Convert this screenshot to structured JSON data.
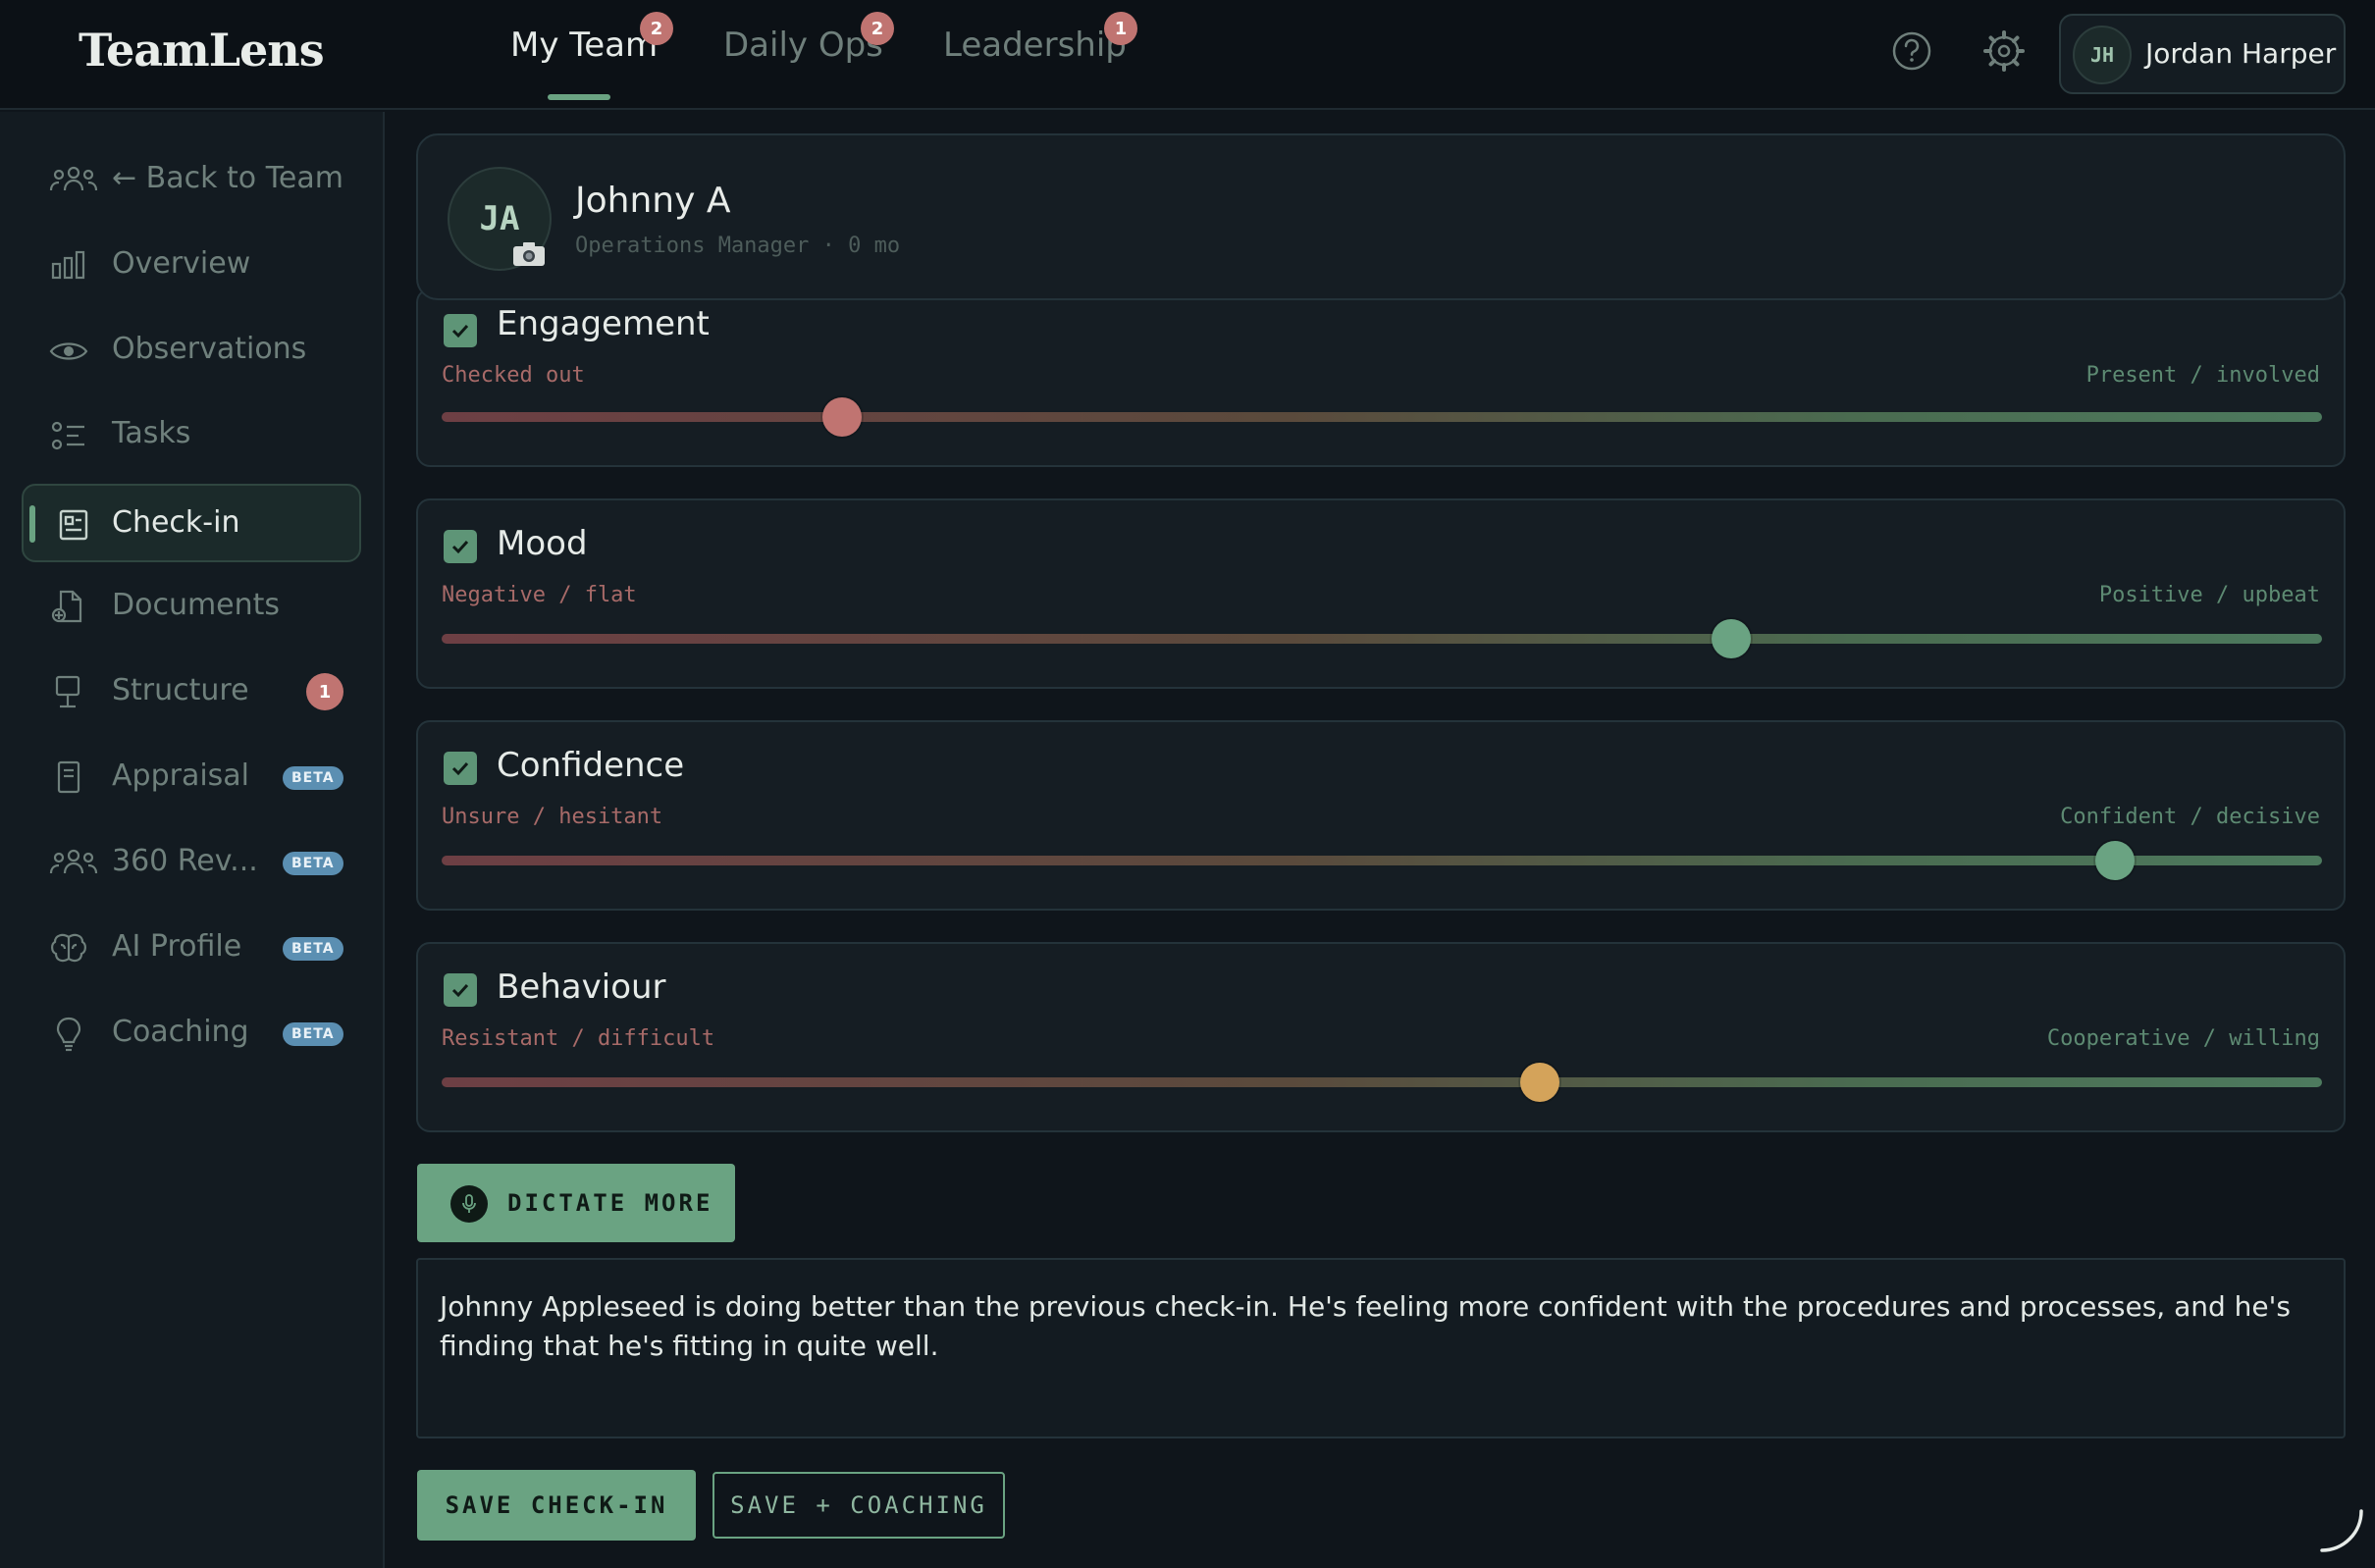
{
  "app": {
    "logo": "TeamLens",
    "tabs": [
      {
        "label": "My Team",
        "badge": "2"
      },
      {
        "label": "Daily Ops",
        "badge": "2"
      },
      {
        "label": "Leadership",
        "badge": "1"
      }
    ],
    "user": {
      "initials": "JH",
      "name": "Jordan Harper"
    }
  },
  "sidebar": {
    "items": [
      {
        "label": "← Back to Team",
        "icon": "people-icon"
      },
      {
        "label": "Overview",
        "icon": "bar-chart-icon"
      },
      {
        "label": "Observations",
        "icon": "eye-icon"
      },
      {
        "label": "Tasks",
        "icon": "checklist-icon"
      },
      {
        "label": "Check-in",
        "icon": "checkin-icon",
        "active": true
      },
      {
        "label": "Documents",
        "icon": "document-add-icon"
      },
      {
        "label": "Structure",
        "icon": "structure-icon",
        "badge": "1"
      },
      {
        "label": "Appraisal",
        "icon": "clipboard-icon",
        "badge": "BETA"
      },
      {
        "label": "360 Rev...",
        "icon": "people-icon",
        "badge": "BETA"
      },
      {
        "label": "AI Profile",
        "icon": "brain-icon",
        "badge": "BETA"
      },
      {
        "label": "Coaching",
        "icon": "lightbulb-icon",
        "badge": "BETA"
      }
    ]
  },
  "profile": {
    "initials": "JA",
    "name": "Johnny A",
    "subtitle": "Operations Manager · 0 mo"
  },
  "metrics": [
    {
      "title": "Engagement",
      "low": "Checked out",
      "high": "Present / involved",
      "value": 0.213,
      "thumb_color": "#c07471"
    },
    {
      "title": "Mood",
      "low": "Negative / flat",
      "high": "Positive / upbeat",
      "value": 0.686,
      "thumb_color": "#6aa382"
    },
    {
      "title": "Confidence",
      "low": "Unsure / hesitant",
      "high": "Confident / decisive",
      "value": 0.89,
      "thumb_color": "#6aa382"
    },
    {
      "title": "Behaviour",
      "low": "Resistant / difficult",
      "high": "Cooperative / willing",
      "value": 0.584,
      "thumb_color": "#d4a35a"
    }
  ],
  "actions": {
    "dictate_label": "DICTATE MORE",
    "notes": "Johnny Appleseed is doing better than the previous check-in. He's feeling more confident with the procedures and processes, and he's finding that he's fitting in quite well.",
    "save_label": "SAVE CHECK-IN",
    "save_coaching_label": "SAVE + COACHING"
  },
  "colors": {
    "accent": "#6aa382",
    "badge": "#c07471",
    "beta": "#5b8fb2",
    "background": "#0f151b"
  }
}
